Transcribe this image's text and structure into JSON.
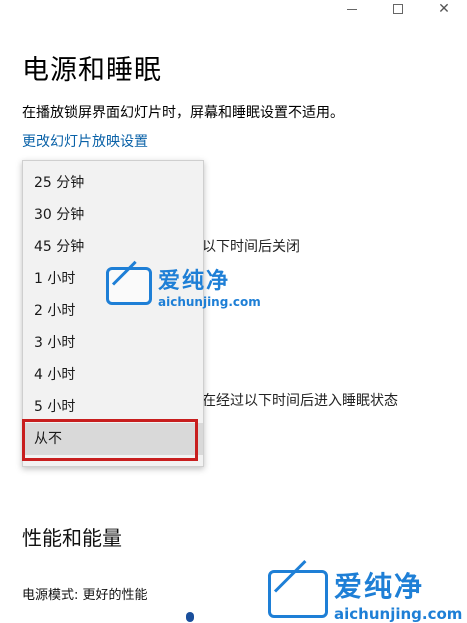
{
  "window": {
    "minimize_icon": "minimize-icon",
    "maximize_icon": "maximize-icon",
    "close_icon": "close-icon"
  },
  "page": {
    "title": "电源和睡眠",
    "info_text": "在播放锁屏界面幻灯片时，屏幕和睡眠设置不适用。",
    "slideshow_link": "更改幻灯片放映设置",
    "screen_off_label_partial": "以下时间后关闭",
    "sleep_label_partial": "在经过以下时间后进入睡眠状态"
  },
  "dropdown": {
    "selected": "从不",
    "options": [
      "25 分钟",
      "30 分钟",
      "45 分钟",
      "1 小时",
      "2 小时",
      "3 小时",
      "4 小时",
      "5 小时",
      "从不"
    ]
  },
  "performance": {
    "heading": "性能和能量",
    "power_mode": "电源模式: 更好的性能"
  },
  "watermark": {
    "cn": "爱纯净",
    "en": "aichunjing.com"
  },
  "colors": {
    "link": "#0a62a8",
    "highlight_border": "#c81e1e",
    "watermark": "#1e7fd6"
  }
}
